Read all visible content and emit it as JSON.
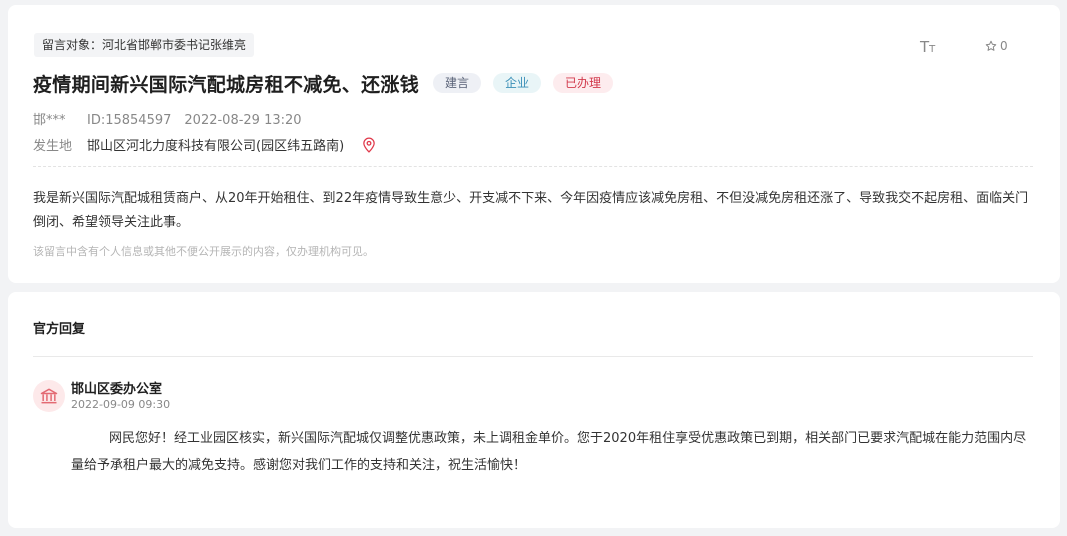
{
  "message": {
    "target_label": "留言对象：",
    "target": "河北省邯郸市委书记张维亮",
    "star_count": "0",
    "title": "疫情期间新兴国际汽配城房租不减免、还涨钱",
    "badges": {
      "type": "建言",
      "field": "企业",
      "status": "已办理"
    },
    "author": "邯***",
    "id": "ID:15854597",
    "datetime": "2022-08-29 13:20",
    "location_label": "发生地",
    "location": "邯山区河北力度科技有限公司(园区纬五路南)",
    "content": "我是新兴国际汽配城租赁商户、从20年开始租住、到22年疫情导致生意少、开支减不下来、今年因疫情应该减免房租、不但没减免房租还涨了、导致我交不起房租、面临关门倒闭、希望领导关注此事。",
    "privacy_note": "该留言中含有个人信息或其他不便公开展示的内容，仅办理机构可见。"
  },
  "reply": {
    "heading": "官方回复",
    "org": "邯山区委办公室",
    "datetime": "2022-09-09 09:30",
    "content": "网民您好！经工业园区核实，新兴国际汽配城仅调整优惠政策，未上调租金单价。您于2020年租住享受优惠政策已到期，相关部门已要求汽配城在能力范围内尽量给予承租户最大的减免支持。感谢您对我们工作的支持和关注，祝生活愉快！"
  },
  "icons": {
    "font_size": "font-size-icon",
    "star": "star-icon",
    "pin": "location-pin-icon",
    "org_avatar": "government-building-icon"
  },
  "colors": {
    "status_red": "#d23a4c",
    "field_blue": "#3a8fb7",
    "pin_red": "#e0394b"
  }
}
